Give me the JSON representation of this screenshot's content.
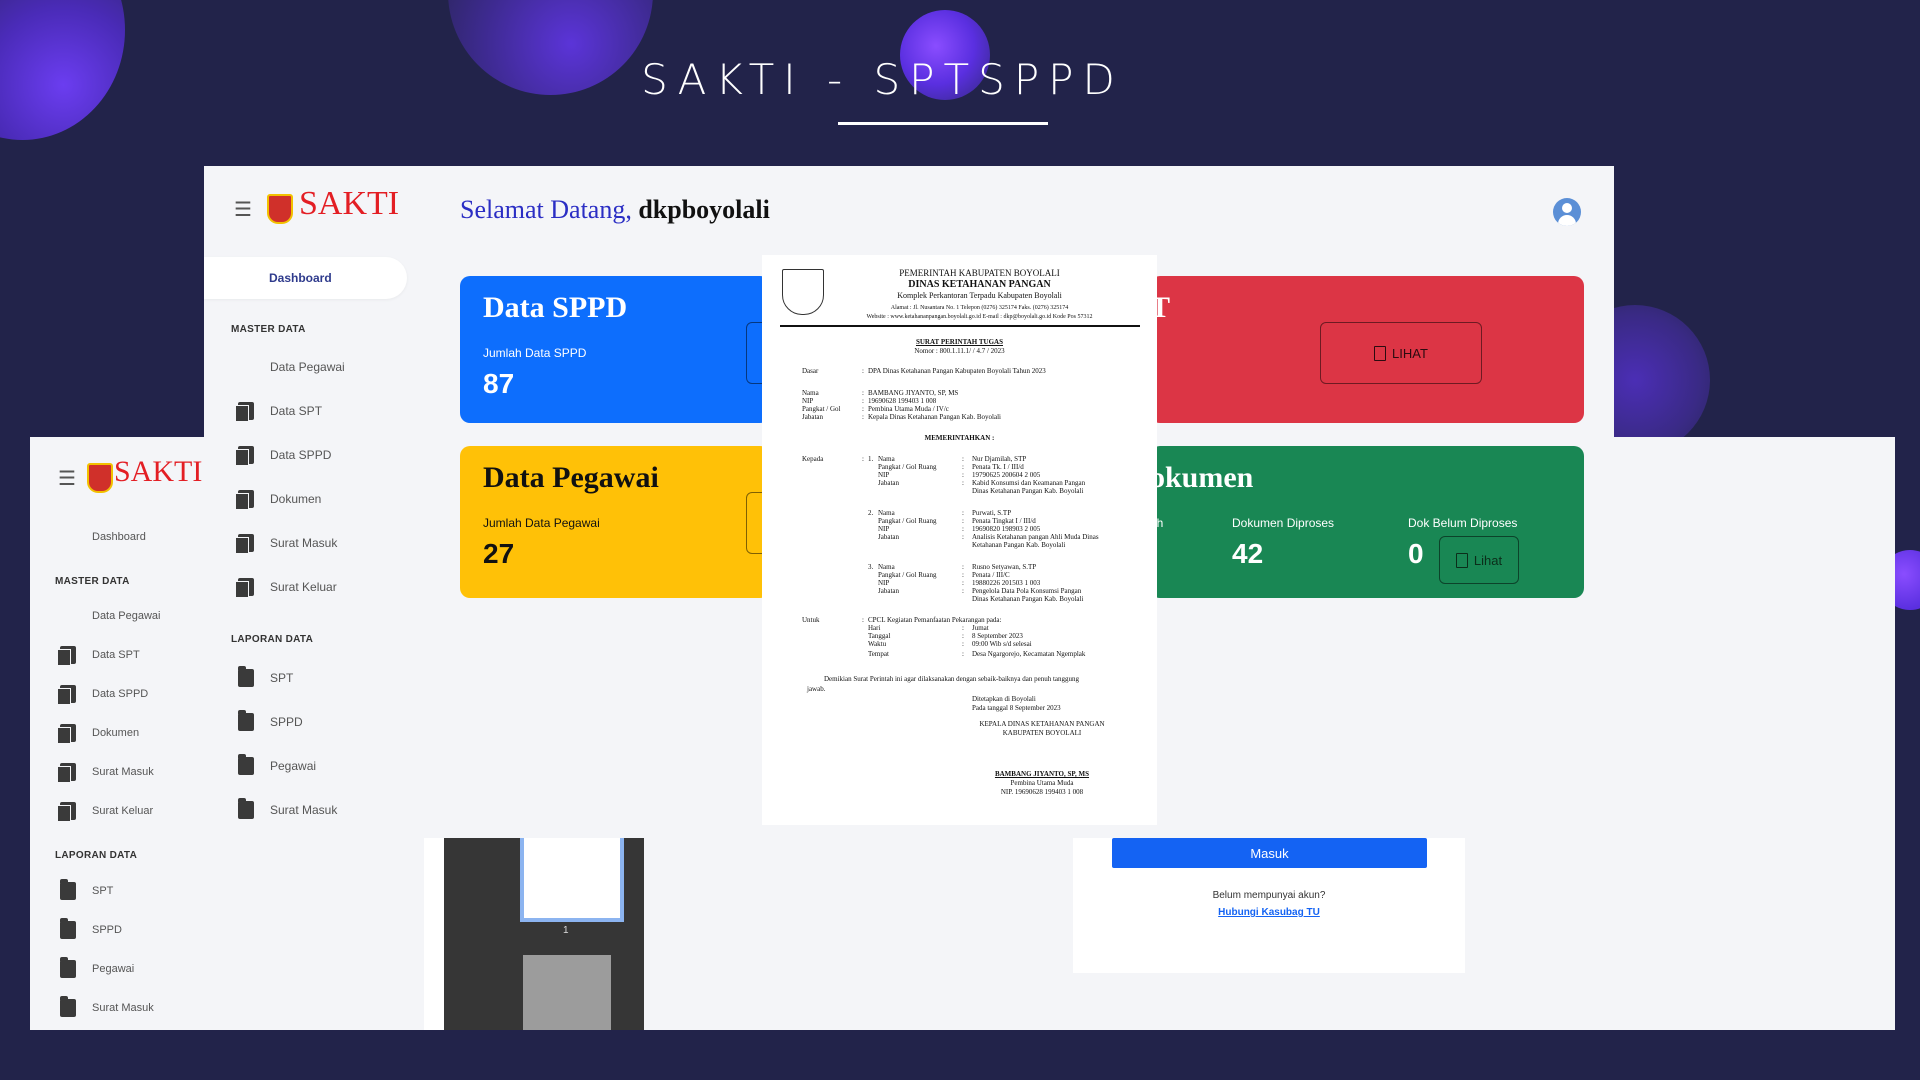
{
  "header": {
    "title": "SAKTI - SPTSPPD"
  },
  "app": {
    "logo_text": "SAKTI",
    "welcome_prefix": "Selamat Datang,",
    "welcome_user": "dkpboyolali",
    "sidebar": {
      "dashboard": "Dashboard",
      "master_section": "MASTER DATA",
      "master_items": [
        "Data Pegawai",
        "Data SPT",
        "Data SPPD",
        "Dokumen",
        "Surat Masuk",
        "Surat Keluar"
      ],
      "report_section": "LAPORAN DATA",
      "report_items": [
        "SPT",
        "SPPD",
        "Pegawai",
        "Surat Masuk"
      ]
    },
    "cards": {
      "sppd": {
        "title": "Data SPPD",
        "label": "Jumlah Data SPPD",
        "value": "87"
      },
      "spt": {
        "title_fragment": "T",
        "button": "LIHAT"
      },
      "pegawai": {
        "title": "Data Pegawai",
        "label": "Jumlah Data Pegawai",
        "value": "27"
      },
      "dokumen": {
        "title_fragment": "okumen",
        "label_fragment": "ah",
        "diproses_label": "Dokumen Diproses",
        "diproses_value": "42",
        "belum_label": "Dok Belum Diproses",
        "belum_value": "0",
        "button": "Lihat"
      }
    },
    "colors": {
      "blue": "#0d6efd",
      "red": "#dc3545",
      "yellow": "#ffc107",
      "green": "#198754",
      "background": "#22234a"
    }
  },
  "document": {
    "gov": "PEMERINTAH KABUPATEN BOYOLALI",
    "office": "DINAS KETAHANAN PANGAN",
    "complex": "Komplek Perkantoran Terpadu Kabupaten Boyolali",
    "address": "Alamat : Jl. Nusantara No. 1  Telepon (0276) 325174   Faks. (0276) 325174",
    "website": "Website : www.ketahananpangan.boyolali.go.id   E-mail : dkp@boyolali.go.id   Kode Pos 57312",
    "doc_title": "SURAT PERINTAH TUGAS",
    "nomor": "Nomor : 800.1.11.1/        / 4.7 / 2023",
    "dasar_label": "Dasar",
    "dasar_value": "DPA Dinas Ketahanan Pangan Kabupaten Boyolali Tahun 2023",
    "issuer_labels": [
      "Nama",
      "NIP",
      "Pangkat / Gol",
      "Jabatan"
    ],
    "issuer_values": [
      "BAMBANG JIYANTO, SP, MS",
      "19690628 199403 1 008",
      "Pembina Utama Muda / IV/c",
      "Kepala Dinas Ketahanan Pangan Kab. Boyolali"
    ],
    "memerintahkan": "MEMERINTAHKAN :",
    "kepada_label": "Kepada",
    "field_labels": [
      "Nama",
      "Pangkat / Gol Ruang",
      "NIP",
      "Jabatan"
    ],
    "persons": [
      {
        "no": "1.",
        "nama": "Nur Djamilah, STP",
        "pangkat": "Penata Tk. I / III/d",
        "nip": "19790625 200604 2 005",
        "jabatan": [
          "Kabid Konsumsi dan Keamanan Pangan",
          "Dinas Ketahanan Pangan Kab. Boyolali"
        ]
      },
      {
        "no": "2.",
        "nama": "Purwati, S.TP",
        "pangkat": "Penata Tingkat I / III/d",
        "nip": "19690820 198903 2 005",
        "jabatan": [
          "Analisis Ketahanan pangan Ahli Muda Dinas",
          "Ketahanan Pangan Kab. Boyolali"
        ]
      },
      {
        "no": "3.",
        "nama": "Rusno Setyawan, S.TP",
        "pangkat": "Penata / III/C",
        "nip": "19880226 201503 1 003",
        "jabatan": [
          "Pengelola Data Pola Konsumsi Pangan",
          "Dinas Ketahanan Pangan Kab. Boyolali"
        ]
      }
    ],
    "untuk_label": "Untuk",
    "untuk_value": "CPCL Kegiatan Pemanfaatan Pekarangan pada:",
    "schedule_labels": [
      "Hari",
      "Tanggal",
      "Waktu",
      "Tempat"
    ],
    "schedule_values": [
      "Jumat",
      "8 September 2023",
      "09:00 Wib s/d selesai",
      "Desa Ngargorejo, Kecamatan Ngemplak"
    ],
    "closing_1": "Demikian Surat Perintah ini agar dilaksanakan dengan sebaik-baiknya dan penuh tanggung",
    "closing_2": "jawab.",
    "ditetapkan": "Ditetapkan di Boyolali",
    "tanggal": "Pada tanggal 8 September 2023",
    "sign_title_1": "KEPALA DINAS KETAHANAN PANGAN",
    "sign_title_2": "KABUPATEN BOYOLALI",
    "sign_name": "BAMBANG JIYANTO, SP, MS",
    "sign_rank": "Pembina Utama Muda",
    "sign_nip": "NIP. 19690628 199403 1 008"
  },
  "pdf_viewer": {
    "page_number": "1"
  },
  "login": {
    "button": "Masuk",
    "prompt": "Belum mempunyai akun?",
    "link": "Hubungi Kasubag TU"
  }
}
